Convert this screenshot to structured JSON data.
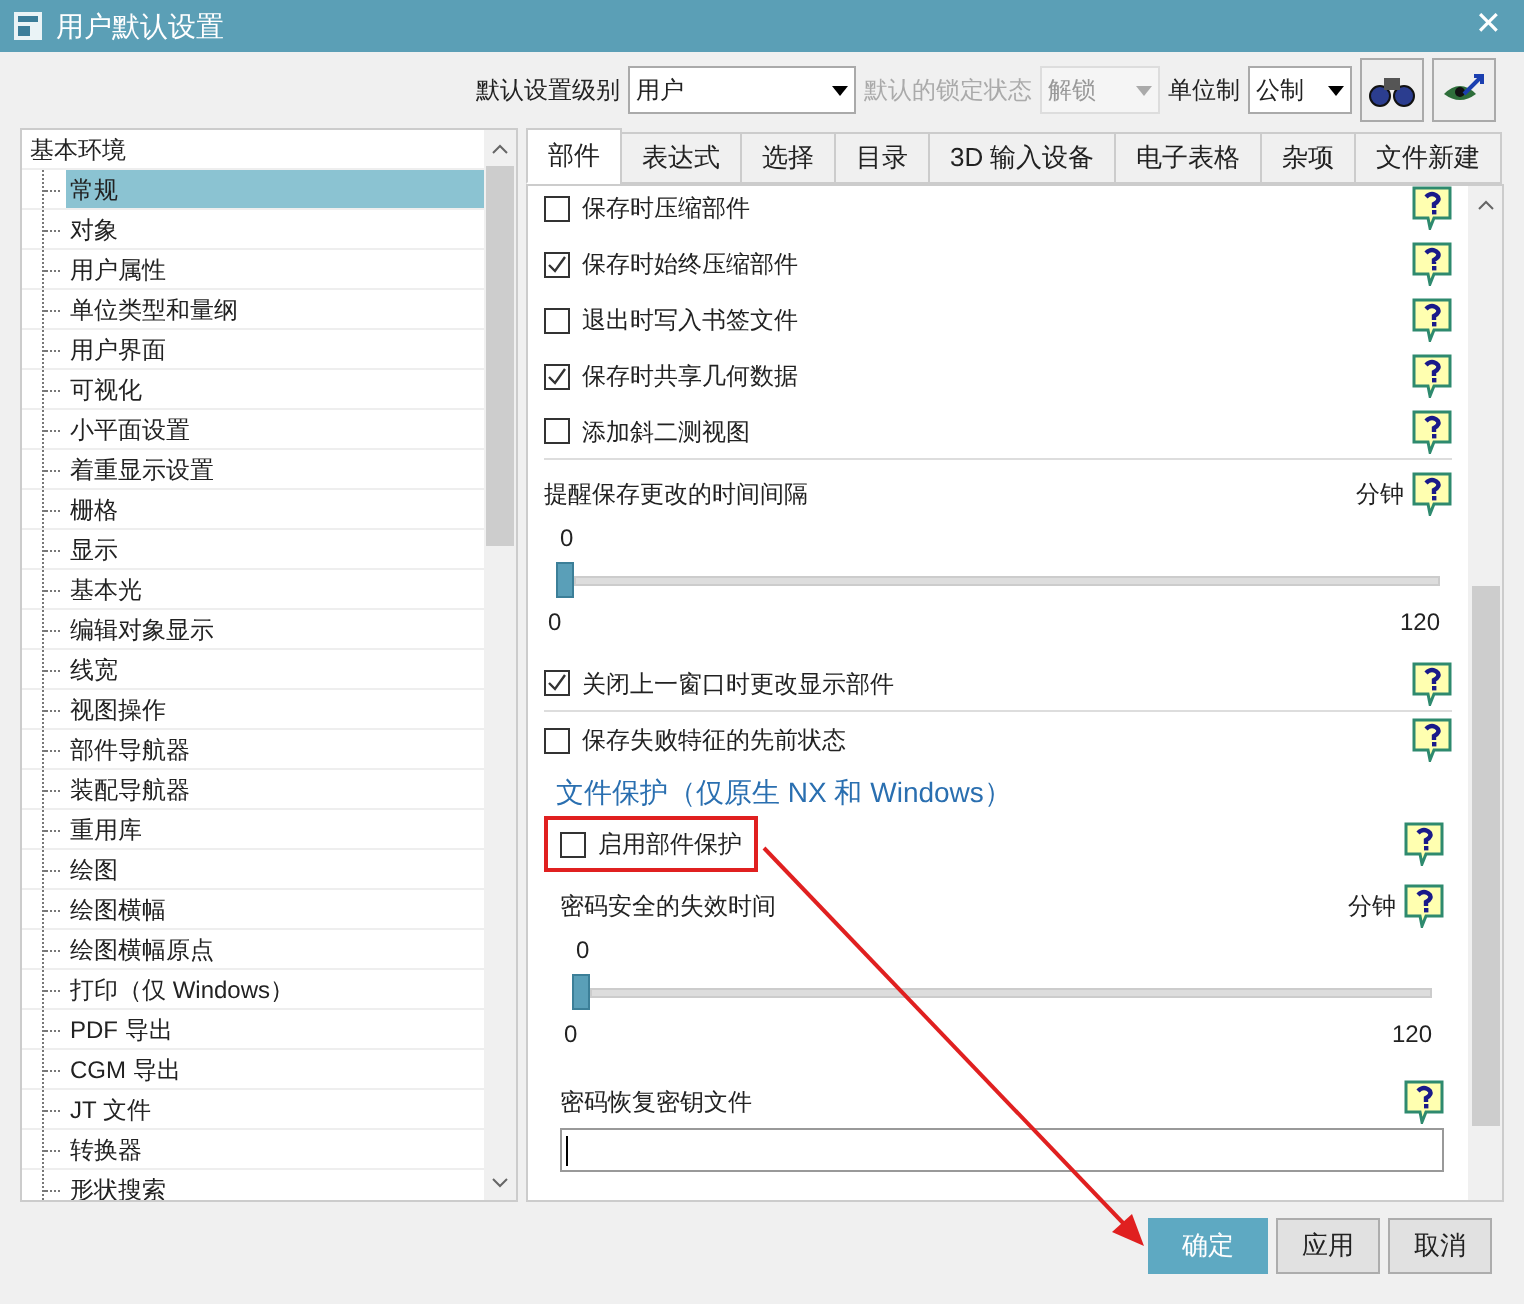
{
  "window": {
    "title": "用户默认设置",
    "close": "✕"
  },
  "toolbar": {
    "level_label": "默认设置级别",
    "level_value": "用户",
    "lock_label": "默认的锁定状态",
    "lock_value": "解锁",
    "lock_disabled": true,
    "unit_label": "单位制",
    "unit_value": "公制"
  },
  "tree": {
    "root": "基本环境",
    "children": [
      {
        "label": "常规",
        "selected": true
      },
      {
        "label": "对象",
        "selected": false
      },
      {
        "label": "用户属性",
        "selected": false
      },
      {
        "label": "单位类型和量纲",
        "selected": false
      },
      {
        "label": "用户界面",
        "selected": false
      },
      {
        "label": "可视化",
        "selected": false
      },
      {
        "label": "小平面设置",
        "selected": false
      },
      {
        "label": "着重显示设置",
        "selected": false
      },
      {
        "label": "栅格",
        "selected": false
      },
      {
        "label": "显示",
        "selected": false
      },
      {
        "label": "基本光",
        "selected": false
      },
      {
        "label": "编辑对象显示",
        "selected": false
      },
      {
        "label": "线宽",
        "selected": false
      },
      {
        "label": "视图操作",
        "selected": false
      },
      {
        "label": "部件导航器",
        "selected": false
      },
      {
        "label": "装配导航器",
        "selected": false
      },
      {
        "label": "重用库",
        "selected": false
      },
      {
        "label": "绘图",
        "selected": false
      },
      {
        "label": "绘图横幅",
        "selected": false
      },
      {
        "label": "绘图横幅原点",
        "selected": false
      },
      {
        "label": "打印（仅 Windows）",
        "selected": false
      },
      {
        "label": "PDF 导出",
        "selected": false
      },
      {
        "label": "CGM 导出",
        "selected": false
      },
      {
        "label": "JT 文件",
        "selected": false
      },
      {
        "label": "转换器",
        "selected": false
      },
      {
        "label": "形状搜索",
        "selected": false
      }
    ]
  },
  "tabs": [
    {
      "label": "部件",
      "selected": true
    },
    {
      "label": "表达式",
      "selected": false
    },
    {
      "label": "选择",
      "selected": false
    },
    {
      "label": "目录",
      "selected": false
    },
    {
      "label": "3D 输入设备",
      "selected": false
    },
    {
      "label": "电子表格",
      "selected": false
    },
    {
      "label": "杂项",
      "selected": false
    },
    {
      "label": "文件新建",
      "selected": false
    }
  ],
  "settings": [
    {
      "kind": "check",
      "label": "保存时压缩部件",
      "checked": false
    },
    {
      "kind": "check",
      "label": "保存时始终压缩部件",
      "checked": true
    },
    {
      "kind": "check",
      "label": "退出时写入书签文件",
      "checked": false
    },
    {
      "kind": "check",
      "label": "保存时共享几何数据",
      "checked": true
    },
    {
      "kind": "check",
      "label": "添加斜二测视图",
      "checked": false,
      "divider": true
    },
    {
      "kind": "slider",
      "label": "提醒保存更改的时间间隔",
      "unit": "分钟",
      "value": "0",
      "level": 0,
      "min": "0",
      "max": "120"
    },
    {
      "kind": "check",
      "label": "关闭上一窗口时更改显示部件",
      "checked": true,
      "divider": true
    },
    {
      "kind": "check",
      "label": "保存失败特征的先前状态",
      "checked": false
    },
    {
      "kind": "section",
      "label": "文件保护（仅原生 NX 和 Windows）",
      "items": [
        {
          "kind": "check",
          "label": "启用部件保护",
          "checked": false,
          "annotated": true
        },
        {
          "kind": "slider",
          "label": "密码安全的失效时间",
          "unit": "分钟",
          "value": "0",
          "level": 0,
          "min": "0",
          "max": "120"
        },
        {
          "kind": "input",
          "label": "密码恢复密钥文件"
        }
      ]
    }
  ],
  "buttons": [
    {
      "label": "确定",
      "default": true
    },
    {
      "label": "应用",
      "default": false
    },
    {
      "label": "取消",
      "default": false
    }
  ]
}
